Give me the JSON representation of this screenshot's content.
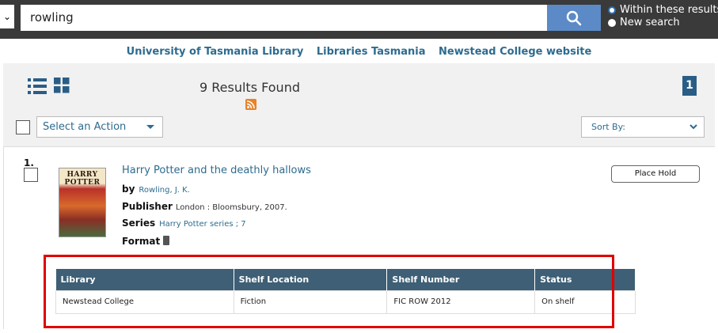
{
  "search": {
    "scope_toggle": "⌄",
    "query": "rowling",
    "radio_within": "Within these results",
    "radio_new": "New search"
  },
  "library_links": [
    "University of Tasmania Library",
    "Libraries Tasmania",
    "Newstead College website"
  ],
  "results": {
    "count_text": "9 Results Found",
    "page": "1",
    "action_placeholder": "Select an Action",
    "sort_label": "Sort By:"
  },
  "item": {
    "number": "1.",
    "cover_line1": "HARRY",
    "cover_line2": "POTTER",
    "title": "Harry Potter and the deathly hallows",
    "by_label": "by",
    "author": "Rowling, J. K.",
    "publisher_label": "Publisher",
    "publisher": "London : Bloomsbury, 2007.",
    "series_label": "Series",
    "series": "Harry Potter series ; 7",
    "format_label": "Format",
    "place_hold": "Place Hold"
  },
  "holdings": {
    "headers": [
      "Library",
      "Shelf Location",
      "Shelf Number",
      "Status"
    ],
    "rows": [
      [
        "Newstead College",
        "Fiction",
        "FIC ROW 2012",
        "On shelf"
      ]
    ]
  },
  "colors": {
    "topbar": "#3a3a3a",
    "search_button": "#5b8ac6",
    "link": "#2d6b8f",
    "table_header": "#3e5f75",
    "highlight": "#e00000"
  }
}
